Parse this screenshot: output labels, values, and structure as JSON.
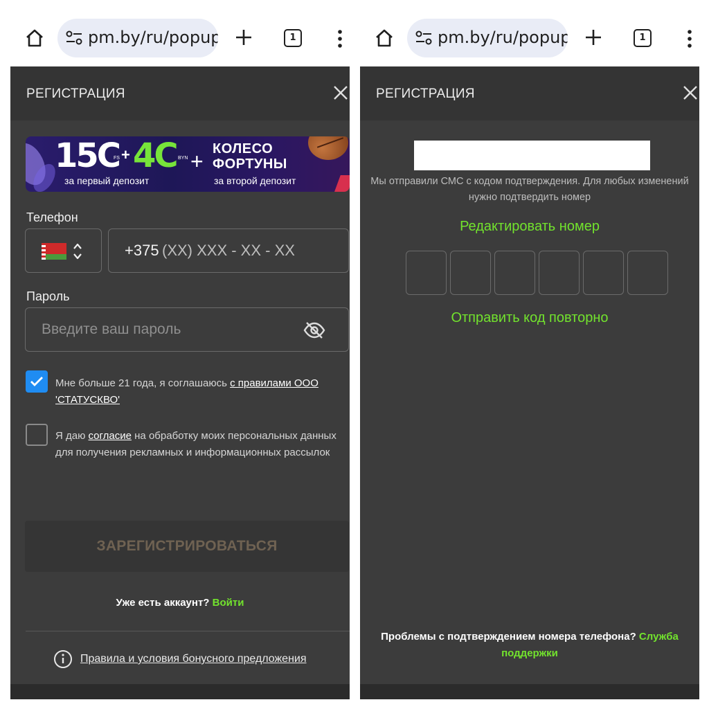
{
  "browser": {
    "url": "pm.by/ru/popup",
    "tab_count": "1"
  },
  "registration": {
    "title": "РЕГИСТРАЦИЯ",
    "banner": {
      "amount_a": "15С",
      "amount_a_unit": "FS",
      "amount_b": "4С",
      "amount_b_unit": "BYN",
      "wheel_line1": "КОЛЕСО",
      "wheel_line2": "ФОРТУНЫ",
      "caption_a": "за первый депозит",
      "caption_b": "за второй депозит"
    },
    "phone": {
      "label": "Телефон",
      "prefix": "+375",
      "mask": "(XX) XXX - XX - XX"
    },
    "password": {
      "label": "Пароль",
      "placeholder": "Введите ваш пароль"
    },
    "consent_age": {
      "text_before": "Мне больше 21 года, я соглашаюсь ",
      "link": "с правилами ООО 'СТАТУСКВО'",
      "checked": true
    },
    "consent_marketing": {
      "text_before": "Я даю ",
      "link": "согласие",
      "text_after": " на обработку моих персональных данных для получения рекламных и информационных рассылок",
      "checked": false
    },
    "submit_label": "ЗАРЕГИСТРИРОВАТЬСЯ",
    "have_account": "Уже есть аккаунт?",
    "login_link": "Войти",
    "bonus_terms": "Правила и условия бонусного предложения"
  },
  "verification": {
    "title": "РЕГИСТРАЦИЯ",
    "sms_info": "Мы отправили СМС с кодом подтверждения. Для любых изменений нужно подтвердить номер",
    "edit_number": "Редактировать номер",
    "code_cells": [
      "",
      "",
      "",
      "",
      "",
      ""
    ],
    "resend": "Отправить код повторно",
    "problem_text": "Проблемы с подтверждением номера телефона?",
    "support_link": "Служба поддержки"
  },
  "colors": {
    "accent_green": "#72e32d",
    "checkbox_blue": "#1f8cf2",
    "panel_bg": "#3c3c3c",
    "header_bg": "#343434"
  }
}
